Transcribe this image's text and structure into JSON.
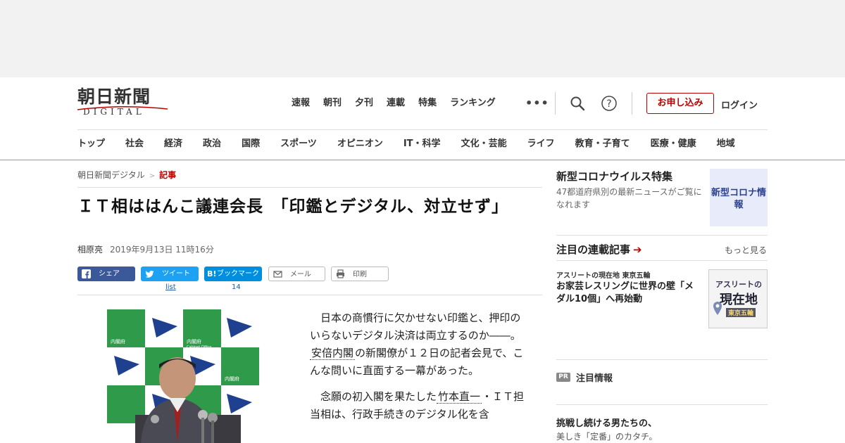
{
  "logo": {
    "kanji": "朝日新聞",
    "sub": "DIGITAL"
  },
  "topnav": [
    "速報",
    "朝刊",
    "夕刊",
    "連載",
    "特集",
    "ランキング"
  ],
  "header": {
    "more_icon": "more-dots-icon",
    "apply_label": "お申し込み",
    "login_label": "ログイン"
  },
  "catnav": [
    "トップ",
    "社会",
    "経済",
    "政治",
    "国際",
    "スポーツ",
    "オピニオン",
    "IT・科学",
    "文化・芸能",
    "ライフ",
    "教育・子育て",
    "医療・健康",
    "地域"
  ],
  "breadcrumb": {
    "home": "朝日新聞デジタル",
    "sep": ">",
    "current": "記事"
  },
  "article": {
    "title": "ＩＴ相ははんこ議連会長　「印鑑とデジタル、対立せず」",
    "author": "相原亮",
    "date": "2019年9月13日 11時16分",
    "paragraphs": [
      {
        "pre": "日本の商慣行に欠かせない印鑑と、押印のいらないデジタル決済は両立するのか――。",
        "link": "安倍内閣",
        "post": "の新閣僚が１２日の記者会見で、こんな問いに直面する一幕があった。"
      },
      {
        "pre": "念願の初入閣を果たした",
        "link": "竹本直一",
        "post": "・ＩＴ担当相は、行政手続きのデジタル化を含"
      }
    ]
  },
  "share": {
    "facebook": "シェア",
    "twitter": "ツイート",
    "hatena": "ブックマーク",
    "mail": "メール",
    "print": "印刷",
    "twitter_count": "list",
    "hatena_count": "14"
  },
  "photo": {
    "placard_top": "内閣府",
    "placard_sub": "Cabinet Office"
  },
  "sidebar": {
    "corona_title": "新型コロナウイルス特集",
    "corona_desc": "47都道府県別の最新ニュースがご覧になれます",
    "corona_img": "新型コロナ情報",
    "series_title": "注目の連載記事",
    "series_more": "もっと見る",
    "series_kicker": "アスリートの現在地 東京五輪",
    "series_headline": "お家芸レスリングに世界の壁「メダル10個」へ再始動",
    "series_img_top": "アスリートの",
    "series_img_main": "現在地",
    "series_img_sub": "東京五輪",
    "pr_badge": "PR",
    "pr_title": "注目情報",
    "pr_headline": "挑戦し続ける男たちの、",
    "pr_sub": "美しき「定番」のカタチ。"
  },
  "colors": {
    "accent": "#bb0000",
    "facebook": "#3b5998",
    "twitter": "#1da1f2",
    "hatena": "#008fde",
    "link_count": "#1a5aa0"
  }
}
